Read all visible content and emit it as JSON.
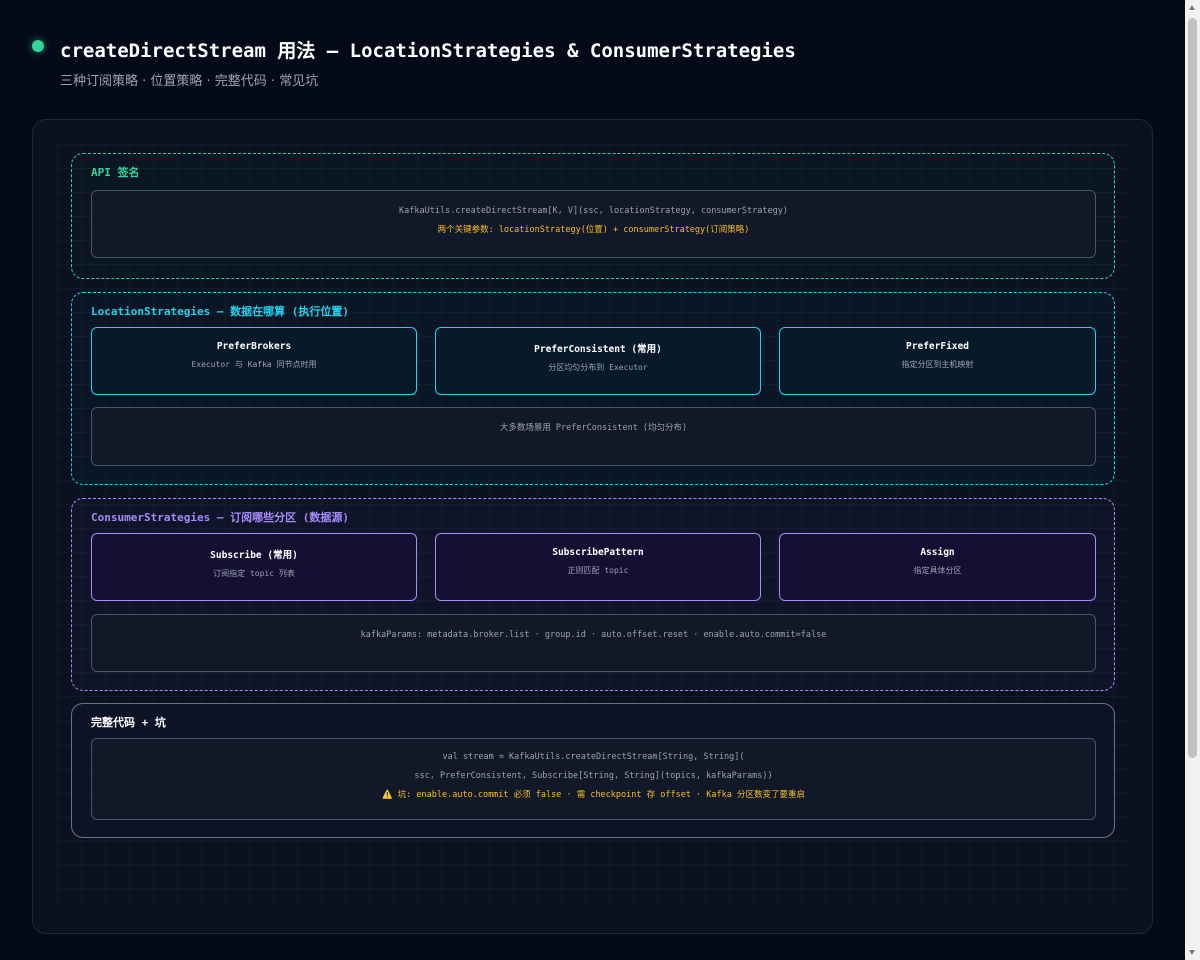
{
  "header": {
    "title": "createDirectStream 用法 — LocationStrategies & ConsumerStrategies",
    "subtitle": "三种订阅策略 · 位置策略 · 完整代码 · 常见坑"
  },
  "colors": {
    "accent_green": "#34d399",
    "accent_cyan": "#22d3ee",
    "accent_purple": "#a78bfa",
    "warning": "#fbbf24",
    "background": "#050a18"
  },
  "api": {
    "label": "API 签名",
    "signature": "KafkaUtils.createDirectStream[K, V](ssc, locationStrategy, consumerStrategy)",
    "note": "两个关键参数: locationStrategy(位置) + consumerStrategy(订阅策略)"
  },
  "location": {
    "label": "LocationStrategies — 数据在哪算 (执行位置)",
    "cards": [
      {
        "title": "PreferBrokers",
        "desc": "Executor 与 Kafka 同节点时用"
      },
      {
        "title": "PreferConsistent (常用)",
        "desc": "分区均匀分布到 Executor"
      },
      {
        "title": "PreferFixed",
        "desc": "指定分区到主机映射"
      }
    ],
    "note": "大多数场景用 PreferConsistent (均匀分布)"
  },
  "consumer": {
    "label": "ConsumerStrategies — 订阅哪些分区 (数据源)",
    "cards": [
      {
        "title": "Subscribe (常用)",
        "desc": "订阅指定 topic 列表"
      },
      {
        "title": "SubscribePattern",
        "desc": "正则匹配 topic"
      },
      {
        "title": "Assign",
        "desc": "指定具体分区"
      }
    ],
    "note": "kafkaParams: metadata.broker.list · group.id · auto.offset.reset · enable.auto.commit=false"
  },
  "code": {
    "label": "完整代码 + 坑",
    "line1": "val stream = KafkaUtils.createDirectStream[String, String](",
    "line2": "ssc, PreferConsistent, Subscribe[String, String](topics, kafkaParams))",
    "warning": "⚠️ 坑: enable.auto.commit 必须 false · 需 checkpoint 存 offset · Kafka 分区数变了要重启"
  }
}
